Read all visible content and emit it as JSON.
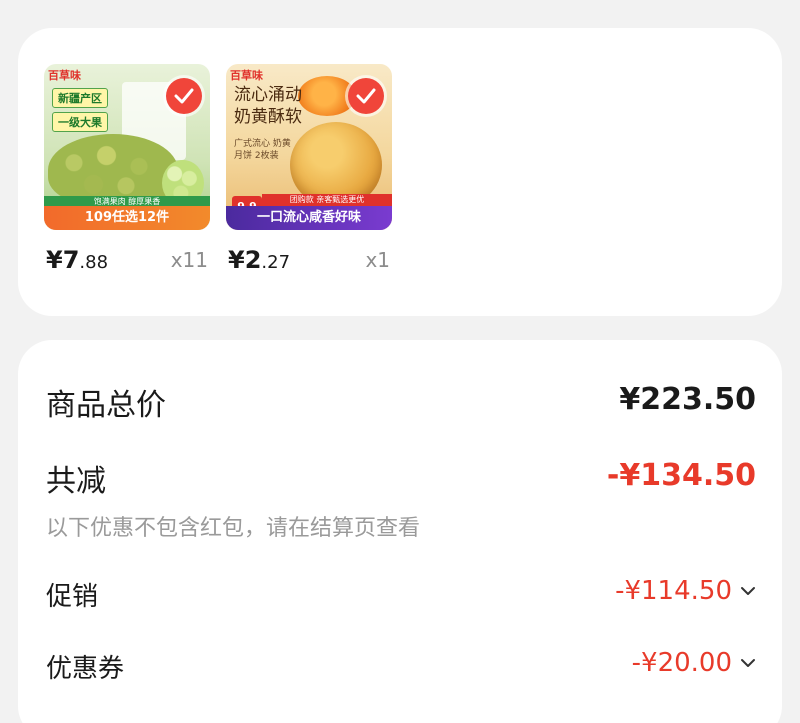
{
  "products": [
    {
      "brand": "百草味",
      "tags": [
        "新疆产区",
        "一级大果"
      ],
      "strip_text": "饱满果肉 醇厚果香",
      "banner": "109任选12件",
      "price_currency": "¥",
      "price_int": "7",
      "price_dec": ".88",
      "quantity": "x11",
      "thumb_icon": "raisin-product-image"
    },
    {
      "brand": "百草味",
      "headline": "流心涌动 奶黄酥软",
      "subline": "广式流心 奶黄月饼 2枚装",
      "price_badge": "9.9",
      "strip_text": "团购款 亲客甄选更优",
      "banner": "一口流心咸香好味",
      "price_currency": "¥",
      "price_int": "2",
      "price_dec": ".27",
      "quantity": "x1",
      "thumb_icon": "mooncake-product-image"
    }
  ],
  "summary": {
    "total_label": "商品总价",
    "total_value": "¥223.50",
    "reduction_label": "共减",
    "reduction_value": "-¥134.50",
    "note": "以下优惠不包含红包，请在结算页查看",
    "promo_label": "促销",
    "promo_value": "-¥114.50",
    "coupon_label": "优惠券",
    "coupon_value": "-¥20.00"
  },
  "colors": {
    "accent_red": "#e83a2a",
    "check_red": "#f0453a",
    "muted_gray": "#9a9a9a",
    "background": "#f2f2f2"
  }
}
